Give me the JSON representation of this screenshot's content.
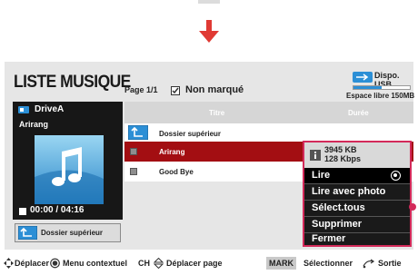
{
  "header": {
    "title": "LISTE MUSIQUE",
    "page": "Page 1/1",
    "marked_status": "Non marqué",
    "usb_label": "Dispo. USB",
    "free_space": "Espace libre 150MB",
    "free_space_fill": 0.5
  },
  "preview": {
    "drive": "DriveA",
    "track": "Arirang",
    "time": "00:00 / 04:16",
    "up_button": "Dossier supérieur"
  },
  "list": {
    "columns": [
      "Titre",
      "Durée"
    ],
    "rows": [
      {
        "label": "Dossier supérieur",
        "icon": "parent-folder-icon"
      },
      {
        "label": "Arirang",
        "icon": "music-file-icon",
        "selected": true
      },
      {
        "label": "Good Bye",
        "icon": "music-file-icon"
      }
    ]
  },
  "context_menu": {
    "file_size": "3945 KB",
    "bitrate": "128 Kbps",
    "items": [
      "Lire",
      "Lire avec photo",
      "Sélect.tous",
      "Supprimer",
      "Fermer"
    ],
    "selected": "Lire"
  },
  "footer": {
    "move": "Déplacer",
    "context_menu": "Menu contextuel",
    "ch": "CH",
    "page_move": "Déplacer page",
    "mark_key": "MARK",
    "select": "Sélectionner",
    "exit": "Sortie"
  },
  "colors": {
    "selection_red": "#a30e12",
    "menu_border": "#d32a5a",
    "usb_blue": "#2c8fd6"
  }
}
